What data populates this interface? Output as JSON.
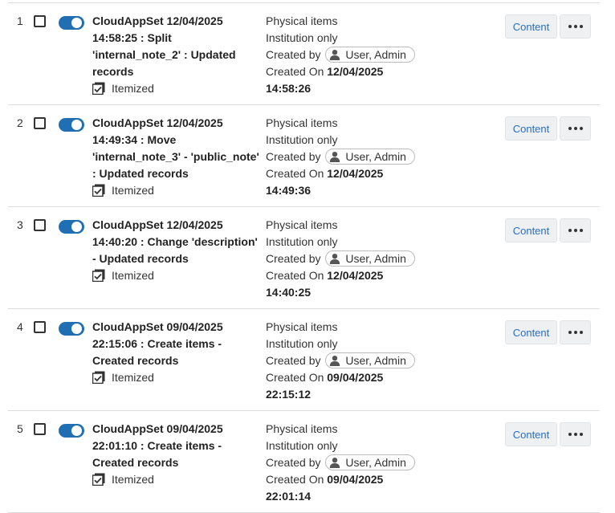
{
  "rows": [
    {
      "index": "1",
      "title": "CloudAppSet 12/04/2025 14:58:25 : Split 'internal_note_2' : Updated records",
      "itemized": "Itemized",
      "material": "Physical items",
      "scope": "Institution only",
      "created_by_label": "Created by",
      "user": "User, Admin",
      "created_on_label": "Created On",
      "created_on_date": "12/04/2025",
      "created_on_time": "14:58:26",
      "content_label": "Content"
    },
    {
      "index": "2",
      "title": "CloudAppSet 12/04/2025 14:49:34 : Move 'internal_note_3' - 'public_note' : Updated records",
      "itemized": "Itemized",
      "material": "Physical items",
      "scope": "Institution only",
      "created_by_label": "Created by",
      "user": "User, Admin",
      "created_on_label": "Created On",
      "created_on_date": "12/04/2025",
      "created_on_time": "14:49:36",
      "content_label": "Content"
    },
    {
      "index": "3",
      "title": "CloudAppSet 12/04/2025 14:40:20 : Change 'description' - Updated records",
      "itemized": "Itemized",
      "material": "Physical items",
      "scope": "Institution only",
      "created_by_label": "Created by",
      "user": "User, Admin",
      "created_on_label": "Created On",
      "created_on_date": "12/04/2025",
      "created_on_time": "14:40:25",
      "content_label": "Content"
    },
    {
      "index": "4",
      "title": "CloudAppSet 09/04/2025 22:15:06 : Create items - Created records",
      "itemized": "Itemized",
      "material": "Physical items",
      "scope": "Institution only",
      "created_by_label": "Created by",
      "user": "User, Admin",
      "created_on_label": "Created On",
      "created_on_date": "09/04/2025",
      "created_on_time": "22:15:12",
      "content_label": "Content"
    },
    {
      "index": "5",
      "title": "CloudAppSet 09/04/2025 22:01:10 : Create items - Created records",
      "itemized": "Itemized",
      "material": "Physical items",
      "scope": "Institution only",
      "created_by_label": "Created by",
      "user": "User, Admin",
      "created_on_label": "Created On",
      "created_on_date": "09/04/2025",
      "created_on_time": "22:01:14",
      "content_label": "Content"
    }
  ],
  "colors": {
    "accent": "#1f6fb2",
    "link": "#2a6ebd",
    "button_bg": "#eef0f2",
    "divider": "#dcdcdc"
  },
  "icons": {
    "itemized": "itemized-checkbox-icon",
    "user": "user-avatar-icon",
    "more": "more-horizontal-icon"
  }
}
